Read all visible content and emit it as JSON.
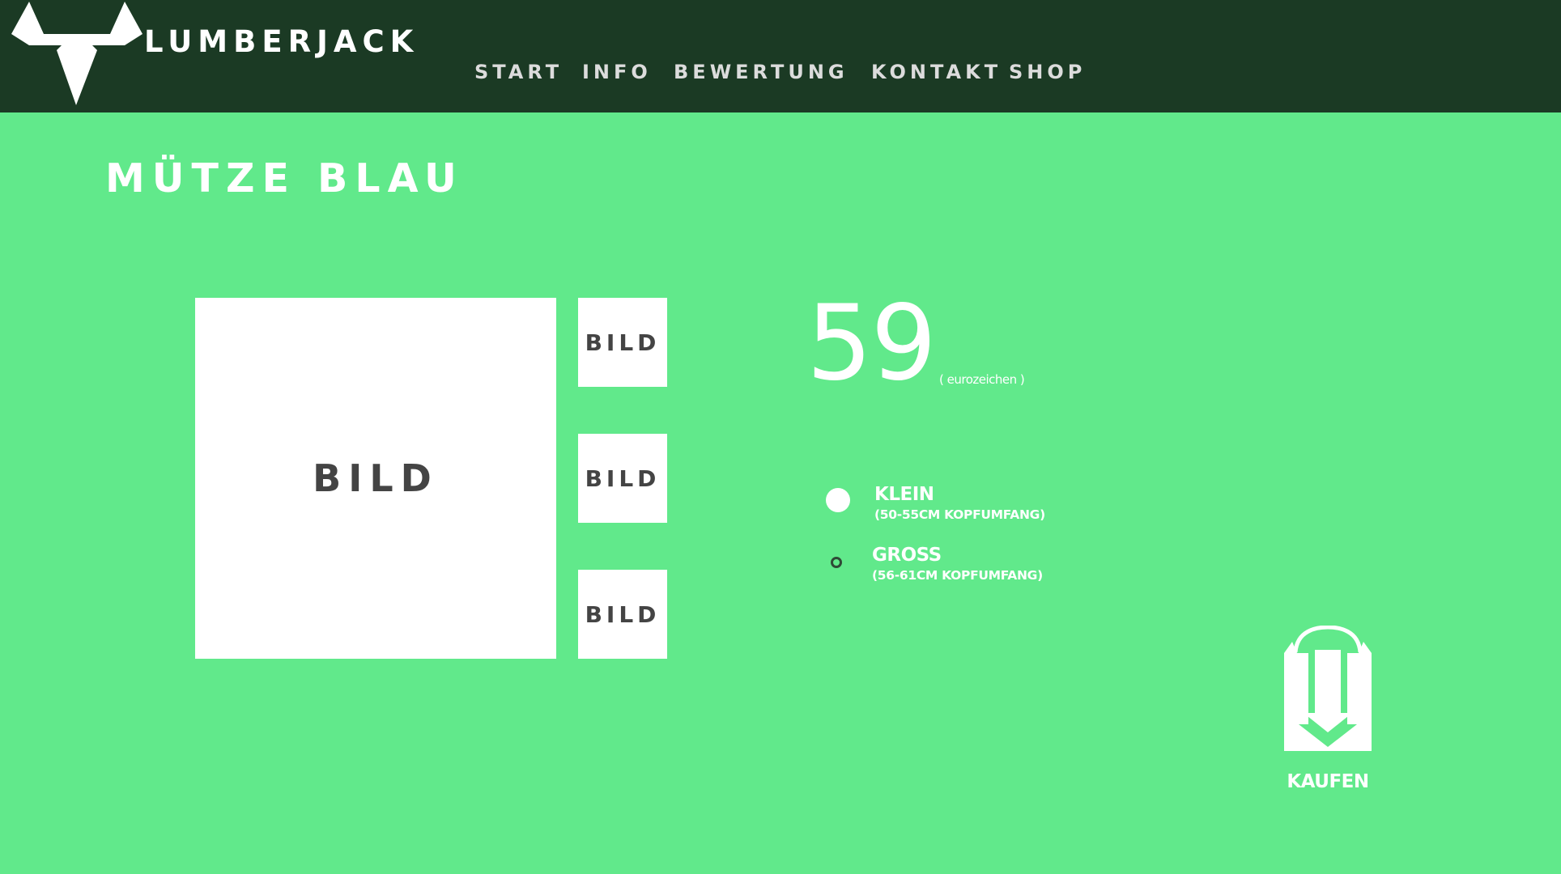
{
  "brand": {
    "name": "LUMBERJACK",
    "logo_icon": "bull-head-icon"
  },
  "nav": {
    "items": [
      {
        "label": "START"
      },
      {
        "label": "INFO"
      },
      {
        "label": "BEWERTUNG"
      },
      {
        "label": "KONTAKT"
      },
      {
        "label": "SHOP"
      }
    ]
  },
  "product": {
    "title": "MÜTZE BLAU",
    "main_image_label": "BILD",
    "thumbnails": [
      {
        "label": "BILD"
      },
      {
        "label": "BILD"
      },
      {
        "label": "BILD"
      }
    ],
    "price": "59",
    "currency_note": "( eurozeichen )",
    "sizes": [
      {
        "label": "KLEIN",
        "detail": "(50-55CM KOPFUMFANG)",
        "selected": true
      },
      {
        "label": "GROSS",
        "detail": "(56-61CM KOPFUMFANG)",
        "selected": false
      }
    ],
    "buy_label": "KAUFEN",
    "buy_icon": "shopping-bag-icon"
  },
  "colors": {
    "header_bg": "#1b3a24",
    "page_bg": "#61e98b",
    "text": "#ffffff",
    "placeholder_text": "#444444"
  }
}
